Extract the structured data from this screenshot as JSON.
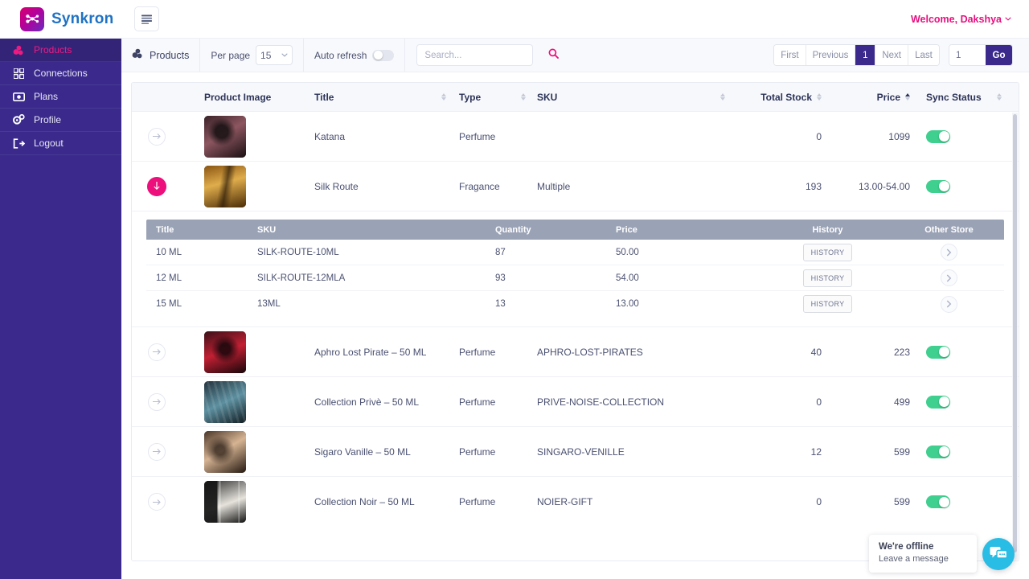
{
  "brand": {
    "name": "Synkron",
    "logo_icon": "synkron-logo-icon",
    "menu_icon": "hamburger-icon"
  },
  "header": {
    "welcome": "Welcome, Dakshya",
    "chevron_icon": "chevron-down-icon"
  },
  "sidebar": {
    "items": [
      {
        "label": "Products",
        "icon": "products-icon",
        "active": true
      },
      {
        "label": "Connections",
        "icon": "connections-icon",
        "active": false
      },
      {
        "label": "Plans",
        "icon": "plans-icon",
        "active": false
      },
      {
        "label": "Profile",
        "icon": "profile-gear-icon",
        "active": false
      },
      {
        "label": "Logout",
        "icon": "logout-icon",
        "active": false
      }
    ]
  },
  "toolbar": {
    "title": "Products",
    "title_icon": "products-icon",
    "per_page_label": "Per page",
    "per_page_value": "15",
    "per_page_caret": "chevron-down-icon",
    "auto_refresh_label": "Auto refresh",
    "auto_refresh_on": false,
    "search_placeholder": "Search...",
    "search_value": "",
    "search_icon": "search-icon"
  },
  "pagination": {
    "first": "First",
    "previous": "Previous",
    "current": "1",
    "next": "Next",
    "last": "Last",
    "goto_value": "1",
    "go": "Go"
  },
  "table": {
    "columns": [
      {
        "key": "image",
        "label": "Product Image",
        "sortable": false
      },
      {
        "key": "title",
        "label": "Title",
        "sortable": true
      },
      {
        "key": "type",
        "label": "Type",
        "sortable": true
      },
      {
        "key": "sku",
        "label": "SKU",
        "sortable": true
      },
      {
        "key": "stock",
        "label": "Total Stock",
        "sortable": true
      },
      {
        "key": "price",
        "label": "Price",
        "sortable": true,
        "sort": "asc"
      },
      {
        "key": "sync",
        "label": "Sync Status",
        "sortable": true
      }
    ],
    "rows": [
      {
        "title": "Katana",
        "type": "Perfume",
        "sku": "",
        "stock": "0",
        "price": "1099",
        "sync_on": true,
        "expanded": false,
        "img": "#2a1a1e,#7a4a52,#120d10"
      },
      {
        "title": "Silk Route",
        "type": "Fragance",
        "sku": "Multiple",
        "stock": "193",
        "price": "13.00-54.00",
        "sync_on": true,
        "expanded": true,
        "img": "#7a4a12,#d9a441,#3a2205"
      },
      {
        "title": "Aphro Lost Pirate – 50 ML",
        "type": "Perfume",
        "sku": "APHRO-LOST-PIRATES",
        "stock": "40",
        "price": "223",
        "sync_on": true,
        "expanded": false,
        "img": "#2a0d12,#b01c2e,#140509"
      },
      {
        "title": "Collection Privè – 50 ML",
        "type": "Perfume",
        "sku": "PRIVE-NOISE-COLLECTION",
        "stock": "0",
        "price": "499",
        "sync_on": true,
        "expanded": false,
        "img": "#1b2a33,#4d7f8c,#0e1a20"
      },
      {
        "title": "Sigaro Vanille – 50 ML",
        "type": "Perfume",
        "sku": "SINGARO-VENILLE",
        "stock": "12",
        "price": "599",
        "sync_on": true,
        "expanded": false,
        "img": "#3a2a20,#caa98c,#1a120c"
      },
      {
        "title": "Collection Noir – 50 ML",
        "type": "Perfume",
        "sku": "NOIER-GIFT",
        "stock": "0",
        "price": "599",
        "sync_on": true,
        "expanded": false,
        "img": "#262626,#d9d9d9,#101010"
      }
    ]
  },
  "subtable": {
    "columns": [
      "Title",
      "SKU",
      "Quantity",
      "Price",
      "History",
      "Other Store"
    ],
    "history_label": "HISTORY",
    "other_store_icon": "chevron-right-icon",
    "rows": [
      {
        "title": "10 ML",
        "sku": "SILK-ROUTE-10ML",
        "quantity": "87",
        "price": "50.00"
      },
      {
        "title": "12 ML",
        "sku": "SILK-ROUTE-12MLA",
        "quantity": "93",
        "price": "54.00"
      },
      {
        "title": "15 ML",
        "sku": "13ML",
        "quantity": "13",
        "price": "13.00"
      }
    ]
  },
  "chat": {
    "line1": "We're offline",
    "line2": "Leave a message",
    "icon": "chat-bubble-icon"
  },
  "colors": {
    "sidebar": "#3b2a8c",
    "accent_pink": "#ec0f7c",
    "brand_blue": "#1f72c4",
    "toggle_green": "#3fcf8e",
    "chat_cyan": "#29bce4"
  }
}
